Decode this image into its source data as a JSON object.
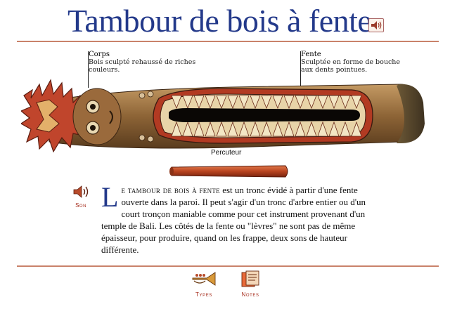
{
  "page": {
    "title": "Tambour de bois à fente"
  },
  "callouts": {
    "corps": {
      "caption": "Corps",
      "description_line1": "Bois sculpté rehaussé de riches",
      "description_line2": "couleurs."
    },
    "fente": {
      "caption": "Fente",
      "description_line1": "Sculptée en forme de bouche",
      "description_line2": "aux dents pointues."
    }
  },
  "beater": {
    "label": "Percuteur"
  },
  "body": {
    "dropcap": "L",
    "lead_smallcaps": "e tambour de bois à fente",
    "text": " est un tronc évidé à partir d'une fente ouverte dans la paroi. Il peut s'agir d'un tronc d'arbre entier ou d'un court tronçon maniable comme pour cet instrument provenant d'un temple de Bali. Les côtés de la fente ou \"lèvres\" ne sont pas de même épaisseur, pour produire, quand on les frappe, deux sons de hauteur différente."
  },
  "controls": {
    "son_label": "Son",
    "types_label": "Types",
    "notes_label": "Notes"
  },
  "icons": {
    "title_audio": "speaker-icon",
    "son": "speaker-icon",
    "types": "trumpet-icon",
    "notes": "notes-icon"
  },
  "colors": {
    "title": "#23398a",
    "rule": "#c9826a",
    "icon_label": "#a52a1a"
  }
}
